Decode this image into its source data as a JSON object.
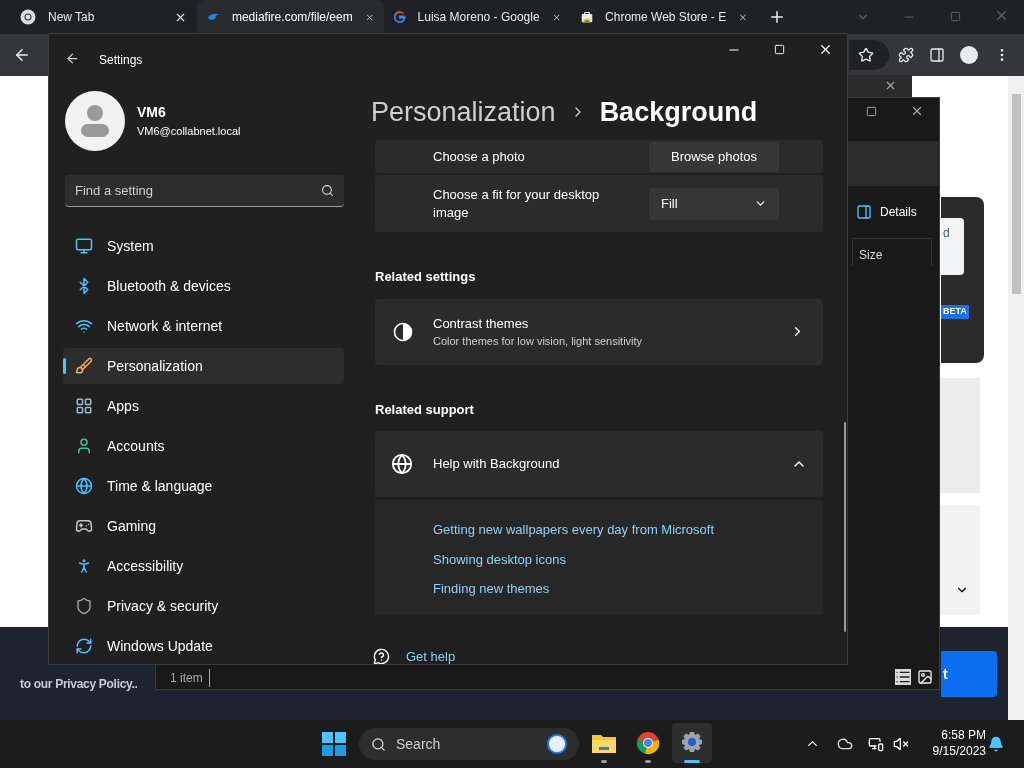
{
  "browser": {
    "tabs": [
      {
        "title": "New Tab",
        "selected": false
      },
      {
        "title": "mediafire.com/file/eem",
        "selected": true
      },
      {
        "title": "Luisa Moreno - Google",
        "selected": false
      },
      {
        "title": "Chrome Web Store - E",
        "selected": false
      }
    ]
  },
  "page": {
    "card_button": "d",
    "badge": "BETA",
    "banner_text": "to our Privacy Policy..",
    "banner_button": "t"
  },
  "explorer": {
    "details": "Details",
    "column": "Size",
    "status": "1 item"
  },
  "settings": {
    "title": "Settings",
    "user": {
      "name": "VM6",
      "email": "VM6@collabnet.local"
    },
    "search": {
      "placeholder": "Find a setting"
    },
    "nav": [
      {
        "label": "System",
        "selected": false
      },
      {
        "label": "Bluetooth & devices",
        "selected": false
      },
      {
        "label": "Network & internet",
        "selected": false
      },
      {
        "label": "Personalization",
        "selected": true
      },
      {
        "label": "Apps",
        "selected": false
      },
      {
        "label": "Accounts",
        "selected": false
      },
      {
        "label": "Time & language",
        "selected": false
      },
      {
        "label": "Gaming",
        "selected": false
      },
      {
        "label": "Accessibility",
        "selected": false
      },
      {
        "label": "Privacy & security",
        "selected": false
      },
      {
        "label": "Windows Update",
        "selected": false
      }
    ],
    "breadcrumb": {
      "parent": "Personalization",
      "current": "Background"
    },
    "rows": [
      {
        "kind": "button",
        "label": "Choose a photo",
        "control": "Browse photos"
      },
      {
        "kind": "dropdown",
        "label": "Choose a fit for your desktop image",
        "control": "Fill"
      }
    ],
    "related_settings": {
      "heading": "Related settings",
      "title": "Contrast themes",
      "subtitle": "Color themes for low vision, light sensitivity"
    },
    "related_support": {
      "heading": "Related support",
      "title": "Help with Background",
      "expanded": true,
      "links": [
        "Getting new wallpapers every day from Microsoft",
        "Showing desktop icons",
        "Finding new themes"
      ]
    },
    "get_help": "Get help"
  },
  "taskbar": {
    "search": {
      "placeholder": "Search"
    },
    "apps": [
      {
        "kind": "explorer",
        "selected": false
      },
      {
        "kind": "chrome",
        "selected": false
      },
      {
        "kind": "settings",
        "selected": true
      }
    ],
    "time": "6:58 PM",
    "date": "9/15/2023"
  }
}
